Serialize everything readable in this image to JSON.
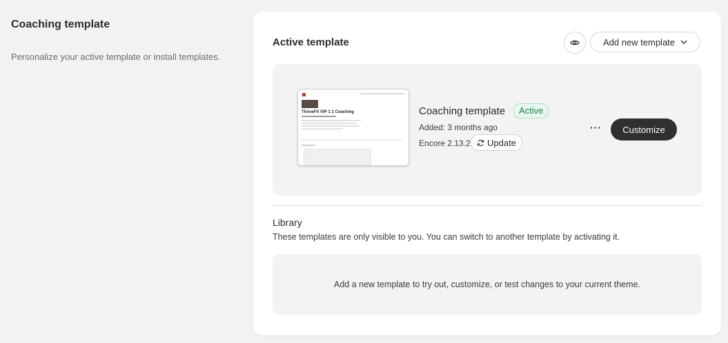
{
  "left": {
    "title": "Coaching template",
    "description": "Personalize your active template or install templates."
  },
  "active": {
    "title": "Active template",
    "preview_icon": "eye-icon",
    "add_button_label": "Add new template",
    "template_name": "Coaching template",
    "status": "Active",
    "added": "Added: 3 months ago",
    "version": "Encore 2.13.2",
    "update_label": "Update",
    "more_label": "···",
    "customize_label": "Customize",
    "thumbnail_title": "ThriveFit VIP 1:1 Coaching"
  },
  "library": {
    "title": "Library",
    "description": "These templates are only visible to you. You can switch to another template by activating it.",
    "empty_message": "Add a new template to try out, customize, or test changes to your current theme."
  },
  "colors": {
    "background": "#f2f2f2",
    "card": "#ffffff",
    "panel": "#f3f3f3",
    "primary_button": "#303030",
    "active_badge_text": "#1e7e45",
    "active_badge_bg": "#e8f8ef"
  }
}
